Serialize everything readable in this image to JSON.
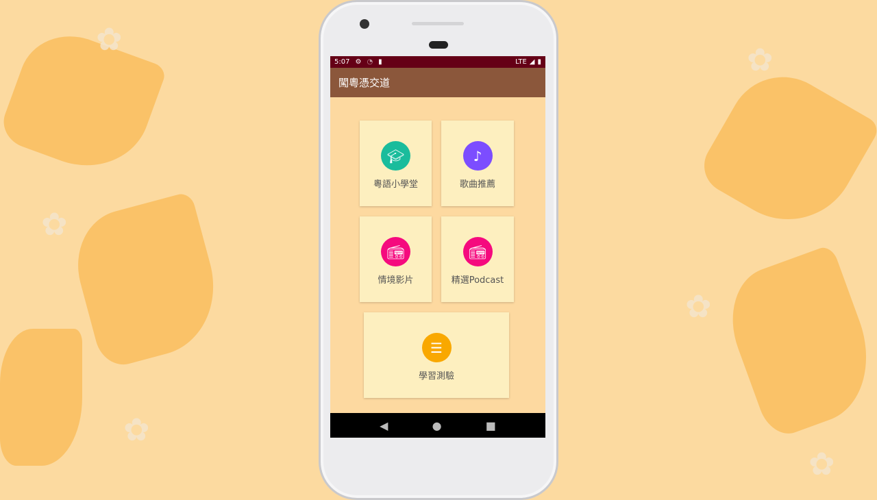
{
  "status_bar": {
    "time": "5:07",
    "network": "LTE"
  },
  "app_bar": {
    "title": "闖粵憑交道"
  },
  "menu": [
    {
      "label": "粵語小學堂",
      "icon": "graduation-cap-icon",
      "color": "#1abc9c"
    },
    {
      "label": "歌曲推薦",
      "icon": "music-note-icon",
      "color": "#7c4dff"
    },
    {
      "label": "情境影片",
      "icon": "radio-icon",
      "color": "#f50a7e"
    },
    {
      "label": "精選Podcast",
      "icon": "radio-icon",
      "color": "#f50a7e"
    },
    {
      "label": "學習測驗",
      "icon": "numbered-list-icon",
      "color": "#f9a800"
    }
  ]
}
